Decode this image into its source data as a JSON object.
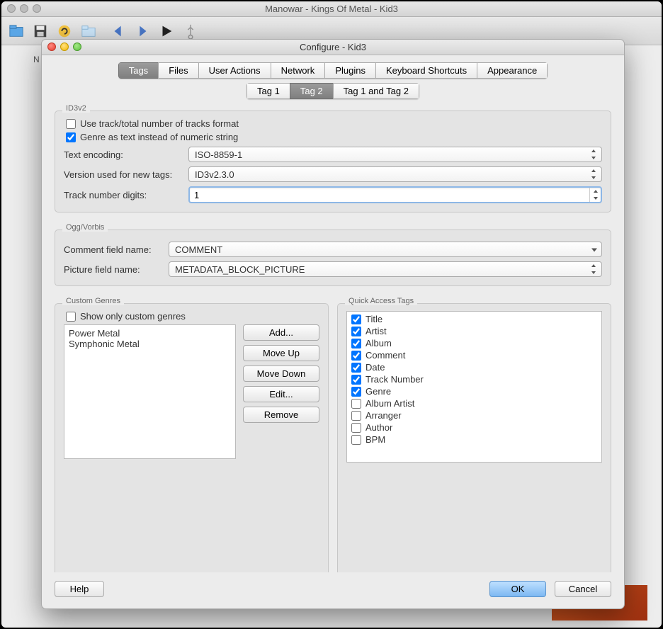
{
  "main_window": {
    "title": "Manowar - Kings Of Metal - Kid3",
    "side_label": "N"
  },
  "dialog": {
    "title": "Configure - Kid3",
    "tabs": [
      "Tags",
      "Files",
      "User Actions",
      "Network",
      "Plugins",
      "Keyboard Shortcuts",
      "Appearance"
    ],
    "active_tab": 0,
    "sub_tabs": [
      "Tag 1",
      "Tag 2",
      "Tag 1 and Tag 2"
    ],
    "active_sub_tab": 1,
    "id3v2": {
      "title": "ID3v2",
      "use_track_total": {
        "label": "Use track/total number of tracks format",
        "checked": false
      },
      "genre_as_text": {
        "label": "Genre as text instead of numeric string",
        "checked": true
      },
      "text_encoding_label": "Text encoding:",
      "text_encoding_value": "ISO-8859-1",
      "version_label": "Version used for new tags:",
      "version_value": "ID3v2.3.0",
      "track_digits_label": "Track number digits:",
      "track_digits_value": "1"
    },
    "ogg": {
      "title": "Ogg/Vorbis",
      "comment_label": "Comment field name:",
      "comment_value": "COMMENT",
      "picture_label": "Picture field name:",
      "picture_value": "METADATA_BLOCK_PICTURE"
    },
    "custom_genres": {
      "title": "Custom Genres",
      "show_only": {
        "label": "Show only custom genres",
        "checked": false
      },
      "items": [
        "Power Metal",
        "Symphonic Metal"
      ],
      "buttons": {
        "add": "Add...",
        "move_up": "Move Up",
        "move_down": "Move Down",
        "edit": "Edit...",
        "remove": "Remove"
      }
    },
    "quick_access": {
      "title": "Quick Access Tags",
      "items": [
        {
          "label": "Title",
          "checked": true
        },
        {
          "label": "Artist",
          "checked": true
        },
        {
          "label": "Album",
          "checked": true
        },
        {
          "label": "Comment",
          "checked": true
        },
        {
          "label": "Date",
          "checked": true
        },
        {
          "label": "Track Number",
          "checked": true
        },
        {
          "label": "Genre",
          "checked": true
        },
        {
          "label": "Album Artist",
          "checked": false
        },
        {
          "label": "Arranger",
          "checked": false
        },
        {
          "label": "Author",
          "checked": false
        },
        {
          "label": "BPM",
          "checked": false
        }
      ]
    },
    "footer": {
      "help": "Help",
      "ok": "OK",
      "cancel": "Cancel"
    }
  }
}
